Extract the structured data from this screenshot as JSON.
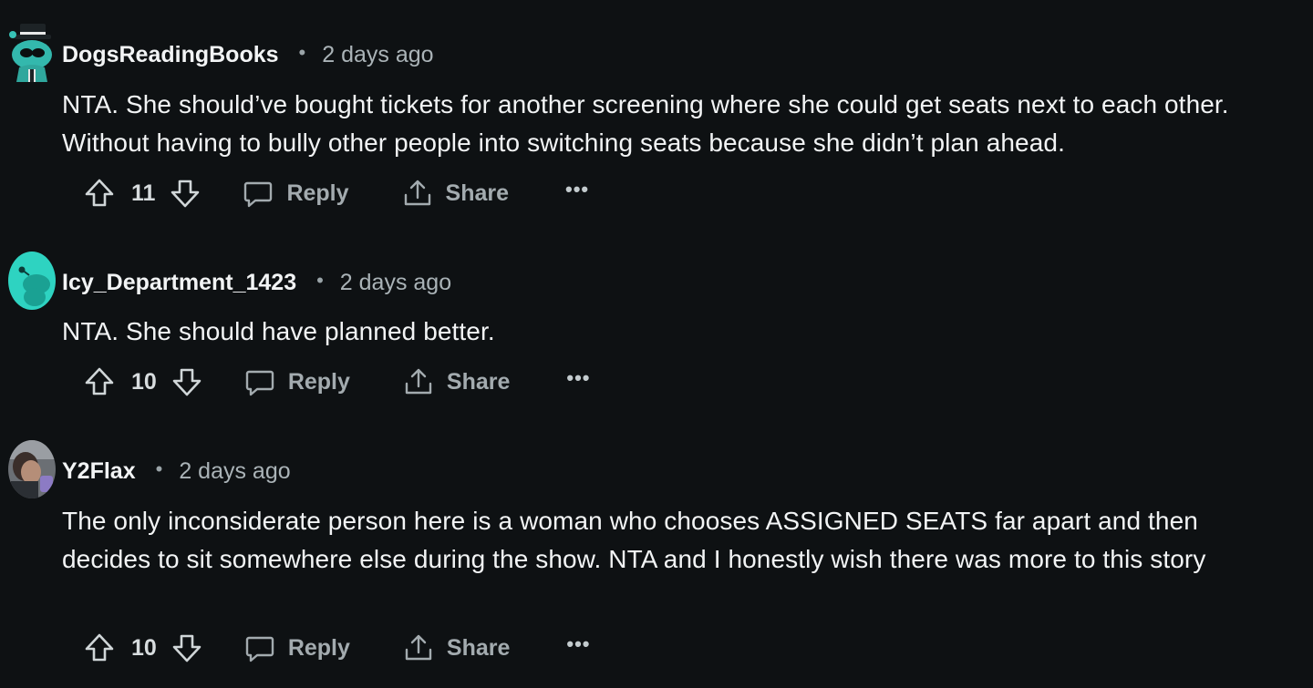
{
  "comments": [
    {
      "username": "DogsReadingBooks",
      "separator": "•",
      "time": "2 days ago",
      "body": "NTA. She should’ve bought tickets for another screening where she could get seats next to each other. Without having to bully other people into switching seats because she didn’t plan ahead.",
      "votes": "11",
      "reply_label": "Reply",
      "share_label": "Share",
      "more_label": "•••",
      "avatar": "teal-snoo-with-top-hat-and-sunglasses"
    },
    {
      "username": "Icy_Department_1423",
      "separator": "•",
      "time": "2 days ago",
      "body": "NTA. She should have planned better.",
      "votes": "10",
      "reply_label": "Reply",
      "share_label": "Share",
      "more_label": "•••",
      "avatar": "default-teal-snoo"
    },
    {
      "username": "Y2Flax",
      "separator": "•",
      "time": "2 days ago",
      "body": "The only inconsiderate person here is a woman who chooses ASSIGNED SEATS far apart and then decides to sit somewhere else during the show. NTA and I honestly wish there was more to this story",
      "votes": "10",
      "reply_label": "Reply",
      "share_label": "Share",
      "more_label": "•••",
      "avatar": "user-photo"
    }
  ],
  "icons": {
    "upvote": "upvote-arrow-icon",
    "downvote": "downvote-arrow-icon",
    "reply": "speech-bubble-icon",
    "share": "share-upload-icon"
  },
  "colors": {
    "background": "#0e1113",
    "text": "#f2f4f5",
    "muted": "#a3abaf",
    "avatar_teal": "#2ec4b6"
  }
}
